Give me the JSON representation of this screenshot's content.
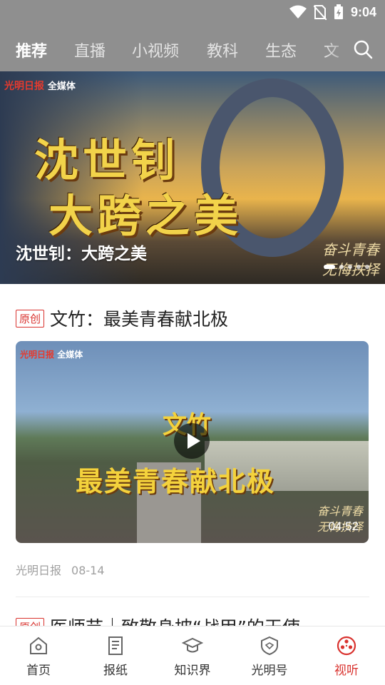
{
  "status_bar": {
    "time": "9:04",
    "icons": [
      "wifi-icon",
      "no-sim-icon",
      "battery-charging-icon"
    ]
  },
  "tabs": [
    {
      "label": "推荐",
      "active": true
    },
    {
      "label": "直播",
      "active": false
    },
    {
      "label": "小视频",
      "active": false
    },
    {
      "label": "教科",
      "active": false
    },
    {
      "label": "生态",
      "active": false
    },
    {
      "label": "文",
      "active": false
    }
  ],
  "banner": {
    "logo": "光明日报",
    "logo_suffix": "全媒体",
    "overlay_title": "沈世钊 大跨之美",
    "caption": "沈世钊：大跨之美",
    "stamp_line1": "奋斗青春",
    "stamp_line2": "无悔扶择",
    "slide_count": 5,
    "active_slide": 1
  },
  "article": {
    "badge": "原创",
    "title": "文竹：最美青春献北极",
    "video": {
      "logo": "光明日报",
      "logo_suffix": "全媒体",
      "overlay_line1": "文竹",
      "overlay_line2": "最美青春献北极",
      "stamp_line1": "奋斗青春",
      "stamp_line2": "无悔扶择",
      "duration": "04:52"
    },
    "source": "光明日报",
    "date": "08-14"
  },
  "next_article": {
    "badge": "原创",
    "title": "医师节｜致敬身披“战甲”的天使"
  },
  "bottom_nav": [
    {
      "label": "首页",
      "icon": "home-icon",
      "active": false
    },
    {
      "label": "报纸",
      "icon": "newspaper-icon",
      "active": false
    },
    {
      "label": "知识界",
      "icon": "graduation-cap-icon",
      "active": false
    },
    {
      "label": "光明号",
      "icon": "shield-icon",
      "active": false
    },
    {
      "label": "视听",
      "icon": "film-reel-icon",
      "active": true
    }
  ],
  "colors": {
    "accent": "#d9322e",
    "header_bg": "#8f8f8f"
  }
}
